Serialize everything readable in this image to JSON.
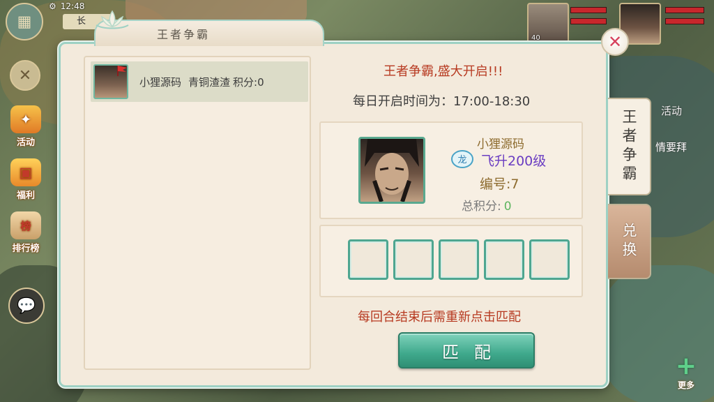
{
  "status": {
    "time": "12:48",
    "location": "长"
  },
  "side_menu": [
    {
      "label": "活动"
    },
    {
      "label": "福利"
    },
    {
      "label": "排行榜",
      "badge": "榜"
    }
  ],
  "top_party": [
    {
      "level": "40"
    }
  ],
  "dialog": {
    "title": "王者争霸",
    "close_symbol": "✕",
    "list": [
      {
        "name": "小狸源码",
        "rank": "青铜渣渣",
        "score": "积分:0"
      }
    ],
    "headline": "王者争霸,盛大开启!!!",
    "open_time": "每日开启时间为：17:00-18:30",
    "player": {
      "name": "小狸源码",
      "badge": "龙",
      "level": "飞升200级",
      "number": "编号:7",
      "score_label": "总积分:",
      "score_value": "0"
    },
    "slot_count": 5,
    "notice": "每回合结束后需重新点击匹配",
    "match_button": "匹配"
  },
  "tabs": [
    {
      "label": "王者争霸",
      "active": true
    },
    {
      "label": "兑换",
      "active": false
    }
  ],
  "background_text": {
    "activity": "活动",
    "side_text": "情要拜",
    "more": "更多"
  },
  "colors": {
    "accent_green": "#3fa98c",
    "headline_red": "#b73a21",
    "level_purple": "#6a3dc2",
    "name_gold": "#8d6b2e"
  }
}
